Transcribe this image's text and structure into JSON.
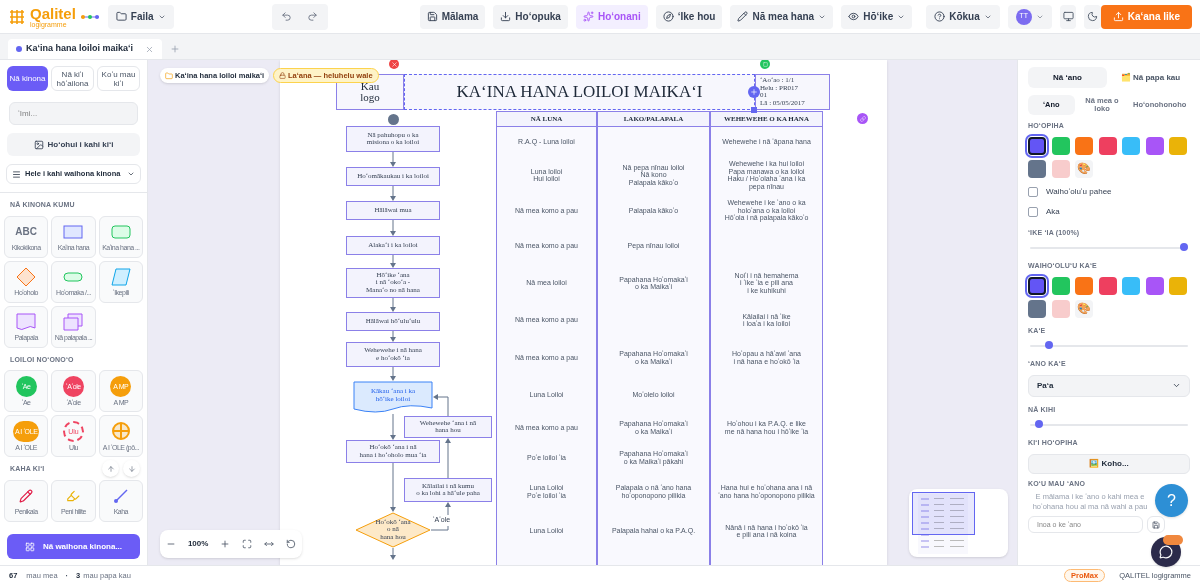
{
  "app": {
    "logo_name": "Qalitel",
    "logo_sub": "logigramme",
    "file_menu": "Faila"
  },
  "toolbar": [
    {
      "kind": "save",
      "label": "Mālama",
      "active": false,
      "dropdown": false
    },
    {
      "kind": "export",
      "label": "Hoʻopuka",
      "active": false,
      "dropdown": false
    },
    {
      "kind": "beautify",
      "label": "Hoʻonani",
      "active": true,
      "dropdown": false
    },
    {
      "kind": "review",
      "label": "ʻIke hou",
      "active": false,
      "dropdown": false
    },
    {
      "kind": "tools",
      "label": "Nā mea hana",
      "active": false,
      "dropdown": true
    },
    {
      "kind": "view",
      "label": "Hōʻike",
      "active": false,
      "dropdown": true
    }
  ],
  "help_menu": "Kōkua",
  "avatar": "TT",
  "share_button": "Kaʻana like",
  "document_tabs": [
    {
      "label": "Kaʻina hana loiloi maikaʻi",
      "selected": true
    }
  ],
  "left_panel": {
    "tabs": [
      {
        "label": "Nā kinona",
        "selected": true
      },
      {
        "label": "Nā kiʻi hōʻailona",
        "selected": false
      },
      {
        "label": "Koʻu mau kiʻi",
        "selected": false
      }
    ],
    "search": {
      "placeholder": "ʻImi..."
    },
    "add_image": "Hoʻohui i kahi kiʻi",
    "library_select": "Hele i kahi waihona kinona",
    "sections": [
      {
        "title": "NĀ KINONA KUMU",
        "items": [
          {
            "kind": "text",
            "glyph": "ABC",
            "label": "Kikokikona"
          },
          {
            "kind": "process",
            "label": "Kaʻina hana"
          },
          {
            "kind": "rounded",
            "label": "Kaʻina hana ..."
          },
          {
            "kind": "decision",
            "label": "Hoʻoholo"
          },
          {
            "kind": "terminal",
            "label": "Hoʻomaka /..."
          },
          {
            "kind": "data",
            "label": "ʻIkepili"
          },
          {
            "kind": "document",
            "label": "Palapala"
          },
          {
            "kind": "documents",
            "label": "Nā palapala ..."
          }
        ]
      },
      {
        "title": "LOILOI NOʻONOʻO",
        "items": [
          {
            "kind": "circle",
            "glyph": "ʻAe",
            "label": "ʻAe",
            "color": "#22c55e"
          },
          {
            "kind": "circle",
            "glyph": "ʻAʻole",
            "label": "ʻAʻole",
            "color": "#ef4461"
          },
          {
            "kind": "circle",
            "glyph": "A MP",
            "label": "A MP",
            "color": "#f59e0b"
          },
          {
            "kind": "circle",
            "glyph": "A I ʻOLE",
            "label": "A I ʻOLE",
            "color": "#f59e0b"
          },
          {
            "kind": "dashed",
            "glyph": "Ulu",
            "label": "Ulu",
            "color": "#ef4461"
          },
          {
            "kind": "cross",
            "label": "A I ʻOLE (pō...",
            "color": "#f59e0b"
          }
        ]
      },
      {
        "title": "KAHA KIʻI",
        "items": [
          {
            "kind": "pencil",
            "label": "Penikala"
          },
          {
            "kind": "highlighter",
            "label": "Peni hilite"
          },
          {
            "kind": "line",
            "label": "Kaha"
          }
        ]
      }
    ],
    "libraries_button": "Nā waihona kinona..."
  },
  "canvas": {
    "breadcrumb": "Kaʻina hana loiloi maikaʻi",
    "lock_badge": "Laʻana — heluhelu wale",
    "zoom": "100%"
  },
  "diagram": {
    "logo": [
      "Kau",
      "logo"
    ],
    "title": {
      "text": "KAʻINA HANA LOILOI MAIKAʻI",
      "selected": true
    },
    "info": [
      "ʻAoʻao : 1/1",
      "Helu : PR017",
      "01",
      "Lā : 05/05/2017"
    ],
    "nodes": [
      {
        "kind": "process",
        "lines": [
          "Nā pahuhopu o ka",
          "misiona o ka loiloi"
        ]
      },
      {
        "kind": "process",
        "lines": [
          "Hoʻomākaukau i ka loiloi"
        ]
      },
      {
        "kind": "process",
        "lines": [
          "Hālāwai mua"
        ]
      },
      {
        "kind": "process",
        "lines": [
          "Alakaʻi i ka loiloi"
        ]
      },
      {
        "kind": "process",
        "lines": [
          "Hōʻike ʻana",
          "i nā ʻokoʻa -",
          "Manaʻo no nā hana"
        ]
      },
      {
        "kind": "process",
        "lines": [
          "Hālāwai hōʻuluʻulu"
        ]
      },
      {
        "kind": "process",
        "lines": [
          "Wehewehe i nā hana",
          "e hoʻokō ʻia"
        ]
      },
      {
        "kind": "document",
        "lines": [
          "Kākau ʻana i ka",
          "hōʻike loiloi"
        ]
      },
      {
        "kind": "process",
        "lines": [
          "Wehewehe ʻana i nā",
          "hana hou"
        ]
      },
      {
        "kind": "process",
        "lines": [
          "Hoʻokō ʻana i nā",
          "hana i hoʻoholo mua ʻia"
        ]
      },
      {
        "kind": "process",
        "lines": [
          "Kālailai i nā kumu",
          "o ka lohi a hāʻule paha"
        ]
      },
      {
        "kind": "decision",
        "lines": [
          "Hoʻokō ʻana",
          "o nā",
          "hana hou"
        ]
      }
    ],
    "no_label": "ʻAʻole",
    "columns": [
      "NĀ LUNA",
      "LAKO/PALAPALA",
      "WEHEWEHE O KA HANA"
    ],
    "rows": [
      {
        "luna": [
          "R.A.Q - Luna loiloi"
        ],
        "wehewehe": [
          "Wehewehe i nā ʻāpana hana"
        ]
      },
      {
        "luna": [
          "Luna loiloi",
          "Hui loiloi"
        ],
        "lako": [
          "Nā pepa nīnau loiloi",
          "Nā kono",
          "Palapala kākoʻo"
        ],
        "wehewehe": [
          "Wehewehe i ka hui loiloi",
          "Papa manawa o ka loiloi",
          "Haku / Hoʻolaha ʻana i ka",
          "pepa nīnau"
        ]
      },
      {
        "luna": [
          "Nā mea komo a pau"
        ],
        "lako": [
          "Palapala kākoʻo"
        ],
        "wehewehe": [
          "Wehewehe i ke ʻano o ka",
          "holoʻana o ka loiloi",
          "Hōʻola i nā palapala kākoʻo"
        ]
      },
      {
        "luna": [
          "Nā mea komo a pau"
        ],
        "lako": [
          "Pepa nīnau loiloi"
        ]
      },
      {
        "luna": [
          "Nā mea loiloi"
        ],
        "lako": [
          "Papahana Hoʻomakaʻi",
          "o ka Maikaʻi"
        ],
        "wehewehe": [
          "Noiʻi i nā hemahema",
          "i ʻike ʻia e pili ana",
          "i ke kuhikuhi"
        ]
      },
      {
        "luna": [
          "Nā mea komo a pau"
        ],
        "wehewehe": [
          "Kālailai i nā ʻike",
          "i loaʻa i ka loiloi"
        ]
      },
      {
        "luna": [
          "Nā mea komo a pau"
        ],
        "lako": [
          "Papahana Hoʻomakaʻi",
          "o ka Maikaʻi"
        ],
        "wehewehe": [
          "Hoʻopau a hāʻawi ʻana",
          "i nā hana e hoʻokō ʻia"
        ]
      },
      {
        "luna": [
          "Luna Loiloi"
        ],
        "lako": [
          "Moʻolelo loiloi"
        ]
      },
      {
        "luna": [
          "Nā mea komo a pau"
        ],
        "lako": [
          "Papahana Hoʻomakaʻi",
          "o ka Maikaʻi"
        ],
        "wehewehe": [
          "Hoʻohou i ka P.A.Q. e like",
          "me nā hana hou i hōʻike ʻia"
        ]
      },
      {
        "luna": [
          "Poʻe loiloi ʻia"
        ],
        "lako": [
          "Papahana Hoʻomakaʻi",
          "o ka Maikaʻi pākahi"
        ]
      },
      {
        "luna": [
          "Luna Loiloi",
          "Poʻe loiloi ʻia"
        ],
        "lako": [
          "Palapala o nā ʻano hana",
          "hoʻoponopono pilikia"
        ],
        "wehewehe": [
          "Hana hui e hoʻohana ana i nā",
          "ʻano hana hoʻoponopono pilikia"
        ]
      },
      {
        "luna": [
          "Luna Loiloi"
        ],
        "lako": [
          "Palapala hahai o ka P.A.Q."
        ],
        "wehewehe": [
          "Nānā i nā hana i hoʻokō ʻia",
          "e pili ana i nā koina"
        ]
      }
    ]
  },
  "right_panel": {
    "tabs": [
      {
        "label": "Nā ʻano",
        "selected": true
      },
      {
        "label": "🗂️ Nā papa kau",
        "selected": false
      }
    ],
    "subtabs": [
      {
        "label": "ʻAno",
        "selected": true
      },
      {
        "label": "Nā mea o loko",
        "selected": false
      },
      {
        "label": "Hoʻonohonoho",
        "selected": false
      }
    ],
    "fill_title": "HOʻOPIHA",
    "fill_swatches": [
      {
        "color": "#6355f5",
        "selected": true
      },
      {
        "color": "#22c55e",
        "selected": false
      },
      {
        "color": "#f97316",
        "selected": false
      },
      {
        "color": "#ee3f5f",
        "selected": false
      },
      {
        "color": "#38bdf8",
        "selected": false
      },
      {
        "color": "#a855f7",
        "selected": false
      },
      {
        "color": "#eab308",
        "selected": false
      },
      {
        "color": "#64748b",
        "selected": false
      },
      {
        "color": "#f8cccc",
        "selected": false
      }
    ],
    "checkboxes": [
      {
        "label": "Waihoʻoluʻu pahee",
        "checked": false
      },
      {
        "label": "Aka",
        "checked": false
      }
    ],
    "opacity": {
      "label": "ʻIKE ʻIA (100%)",
      "level": 1
    },
    "border_title": "WAIHOʻOLUʻU KAʻE",
    "border_swatches": [
      {
        "color": "#6355f5",
        "selected": true
      },
      {
        "color": "#22c55e",
        "selected": false
      },
      {
        "color": "#f97316",
        "selected": false
      },
      {
        "color": "#ee3f5f",
        "selected": false
      },
      {
        "color": "#38bdf8",
        "selected": false
      },
      {
        "color": "#a855f7",
        "selected": false
      },
      {
        "color": "#eab308",
        "selected": false
      },
      {
        "color": "#64748b",
        "selected": false
      },
      {
        "color": "#f8cccc",
        "selected": false
      }
    ],
    "border_width": {
      "label": "KAʻE",
      "level": 0.1
    },
    "border_style": {
      "label": "ʻANO KAʻE",
      "value": "Paʻa"
    },
    "corners": {
      "label": "NĀ KIHI",
      "level": 0.03
    },
    "fill_image": {
      "label": "KIʻI HOʻOPIHA",
      "button": "🖼️ Koho..."
    },
    "my_styles": {
      "label": "KOʻU MAU ʻANO",
      "hint": "E mālama i ke ʻano o kahi mea e hoʻohana hou ai ma nā wahi a pau",
      "placeholder": "Inoa o ke ʻano"
    },
    "palette_emoji": "🎨"
  },
  "help_button": "?",
  "status_bar": {
    "items_count": "67",
    "items_label": "mau mea",
    "separator": "·",
    "layers_count": "3",
    "layers_label": "mau papa kau",
    "plan": "ProMax",
    "product": "QALITEL logigramme"
  }
}
